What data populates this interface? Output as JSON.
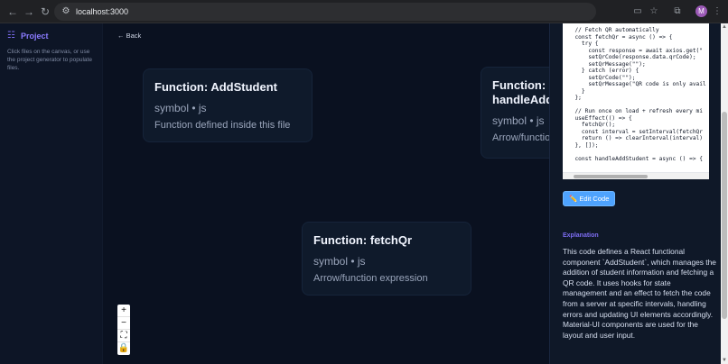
{
  "browser": {
    "url": "localhost:3000",
    "avatar_letter": "M",
    "icons": [
      "back-arrow-icon",
      "forward-arrow-icon",
      "reload-icon",
      "site-info-icon",
      "install-icon",
      "bookmark-star-icon",
      "extensions-icon",
      "menu-dots-icon"
    ]
  },
  "sidebar": {
    "brand": "Project",
    "hint": "Click files on the canvas, or use the project generator to populate files."
  },
  "canvas": {
    "back_label": "← Back",
    "cards": [
      {
        "title": "Function: AddStudent",
        "meta": "symbol • js",
        "desc": "Function defined inside this file"
      },
      {
        "title": "Function: handleAdd",
        "meta": "symbol • js",
        "desc": "Arrow/function"
      },
      {
        "title": "Function: fetchQr",
        "meta": "symbol • js",
        "desc": "Arrow/function expression"
      }
    ],
    "zoom": {
      "zoom_in": "+",
      "zoom_out": "−",
      "fit_view": "⛶",
      "lock": "🔒"
    }
  },
  "panel": {
    "code_lines": [
      "  // Fetch QR automatically",
      "  const fetchQr = async () => {",
      "    try {",
      "      const response = await axios.get(\"",
      "      setQrCode(response.data.qrCode);",
      "      setQrMessage(\"\");",
      "    } catch (error) {",
      "      setQrCode(\"\");",
      "      setQrMessage(\"QR code is only avail",
      "    }",
      "  };",
      "",
      "  // Run once on load + refresh every mi",
      "  useEffect(() => {",
      "    fetchQr();",
      "    const interval = setInterval(fetchQr",
      "    return () => clearInterval(interval)",
      "  }, []);",
      "",
      "  const handleAddStudent = async () => {"
    ],
    "edit_label": "✏️ Edit Code",
    "explanation_title": "Explanation",
    "explanation_text": "This code defines a React functional component `AddStudent`, which manages the addition of student information and fetching a QR code. It uses hooks for state management and an effect to fetch the code from a server at specific intervals, handling errors and updating UI elements accordingly. Material-UI components are used for the layout and user input."
  }
}
